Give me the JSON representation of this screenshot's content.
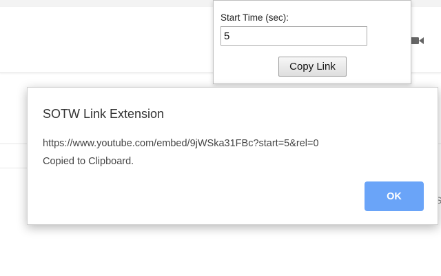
{
  "popup": {
    "label": "Start Time (sec):",
    "input_value": "5",
    "button_label": "Copy Link"
  },
  "dialog": {
    "title": "SOTW Link Extension",
    "message_lines": [
      "https://www.youtube.com/embed/9jWSka31FBc?start=5&rel=0",
      "Copied to Clipboard."
    ],
    "ok_label": "OK"
  },
  "background": {
    "partial_glyph": "S"
  },
  "icons": {
    "background_icon": "video-camera-icon"
  },
  "colors": {
    "ok_button": "#6aa4f8",
    "ok_text": "#ffffff"
  }
}
